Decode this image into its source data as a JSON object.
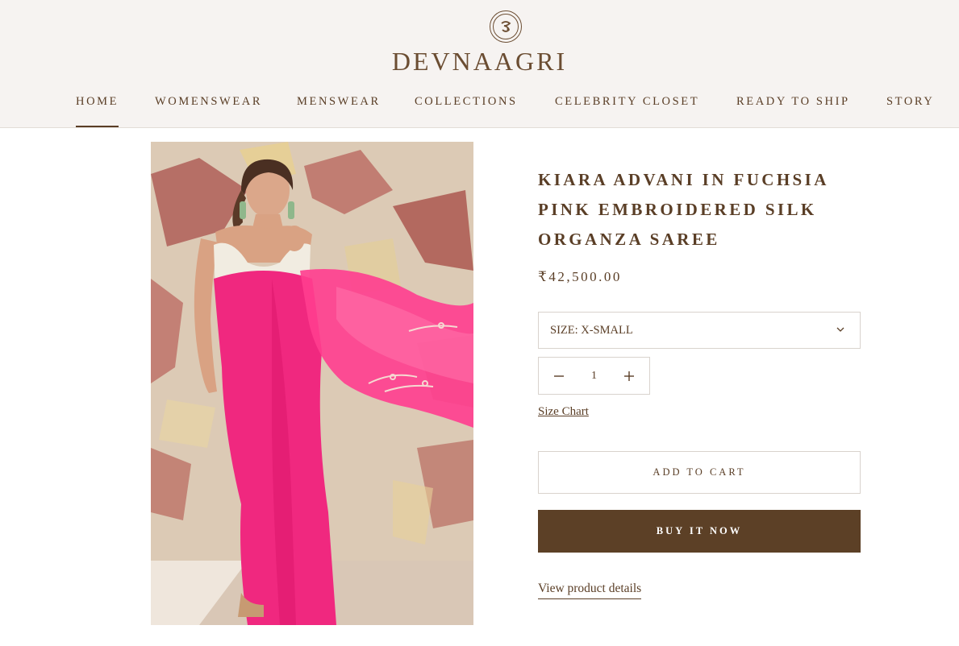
{
  "brand": {
    "name": "DEVNAAGRI"
  },
  "nav": {
    "items": [
      {
        "label": "HOME",
        "active": true
      },
      {
        "label": "WOMENSWEAR"
      },
      {
        "label": "MENSWEAR"
      },
      {
        "label": "COLLECTIONS"
      },
      {
        "label": "CELEBRITY CLOSET"
      },
      {
        "label": "READY TO SHIP"
      },
      {
        "label": "STORY"
      }
    ]
  },
  "product": {
    "title_line1": "KIARA ADVANI IN FUCHSIA",
    "title_line2": "PINK EMBROIDERED SILK",
    "title_line3": "ORGANZA SAREE",
    "price": "₹42,500.00",
    "size_label": "SIZE: X-SMALL",
    "quantity": "1",
    "size_chart_label": "Size Chart",
    "add_to_cart_label": "ADD TO CART",
    "buy_now_label": "BUY IT NOW",
    "details_link_label": "View product details"
  },
  "colors": {
    "brand_brown": "#5c4026",
    "header_bg": "#f6f3f1",
    "saree_pink": "#f0287f"
  }
}
